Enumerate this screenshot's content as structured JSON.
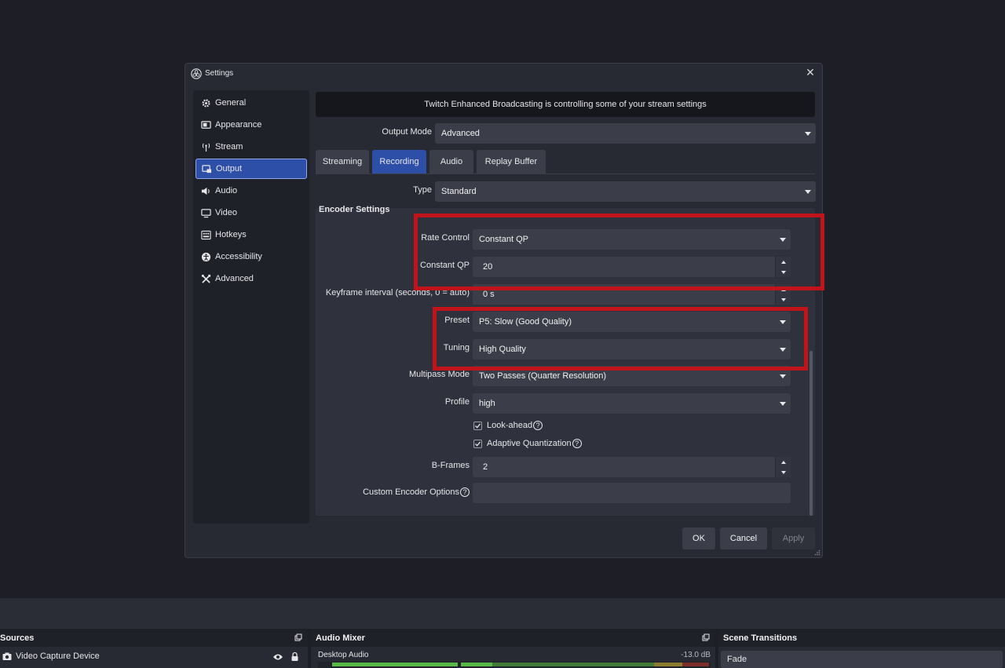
{
  "dialog": {
    "title": "Settings",
    "close_glyph": "✕"
  },
  "sidebar": {
    "items": [
      {
        "label": "General",
        "icon": "gear-icon"
      },
      {
        "label": "Appearance",
        "icon": "appearance-icon"
      },
      {
        "label": "Stream",
        "icon": "antenna-icon"
      },
      {
        "label": "Output",
        "icon": "monitor-output-icon",
        "active": true
      },
      {
        "label": "Audio",
        "icon": "speaker-icon"
      },
      {
        "label": "Video",
        "icon": "monitor-icon"
      },
      {
        "label": "Hotkeys",
        "icon": "keyboard-icon"
      },
      {
        "label": "Accessibility",
        "icon": "accessibility-icon"
      },
      {
        "label": "Advanced",
        "icon": "tools-icon"
      }
    ]
  },
  "banner": "Twitch Enhanced Broadcasting is controlling some of your stream settings",
  "output_mode": {
    "label": "Output Mode",
    "value": "Advanced"
  },
  "tabs": [
    {
      "label": "Streaming"
    },
    {
      "label": "Recording",
      "active": true
    },
    {
      "label": "Audio"
    },
    {
      "label": "Replay Buffer"
    }
  ],
  "type": {
    "label": "Type",
    "value": "Standard"
  },
  "encoder": {
    "section_title": "Encoder Settings",
    "rate_control": {
      "label": "Rate Control",
      "value": "Constant QP"
    },
    "constant_qp": {
      "label": "Constant QP",
      "value": "20"
    },
    "keyframe": {
      "label": "Keyframe interval (seconds, 0 = auto)",
      "value": "0 s"
    },
    "preset": {
      "label": "Preset",
      "value": "P5: Slow (Good Quality)"
    },
    "tuning": {
      "label": "Tuning",
      "value": "High Quality"
    },
    "multipass": {
      "label": "Multipass Mode",
      "value": "Two Passes (Quarter Resolution)"
    },
    "profile": {
      "label": "Profile",
      "value": "high"
    },
    "lookahead": {
      "label": "Look-ahead",
      "checked": true
    },
    "adaptive_quant": {
      "label": "Adaptive Quantization",
      "checked": true
    },
    "bframes": {
      "label": "B-Frames",
      "value": "2"
    },
    "custom_options": {
      "label": "Custom Encoder Options",
      "value": ""
    }
  },
  "help_glyph": "?",
  "buttons": {
    "ok": "OK",
    "cancel": "Cancel",
    "apply": "Apply"
  },
  "docks": {
    "sources": {
      "title": "Sources",
      "item": "Video Capture Device"
    },
    "audio_mixer": {
      "title": "Audio Mixer",
      "channel": "Desktop Audio",
      "level": "-13.0 dB"
    },
    "scene_transitions": {
      "title": "Scene Transitions",
      "value": "Fade"
    }
  },
  "colors": {
    "accent": "#2e4fa8",
    "annotation": "#c0141a",
    "meter_green": "#57b847",
    "meter_yellow": "#b3a13a",
    "meter_red": "#b03a32"
  }
}
